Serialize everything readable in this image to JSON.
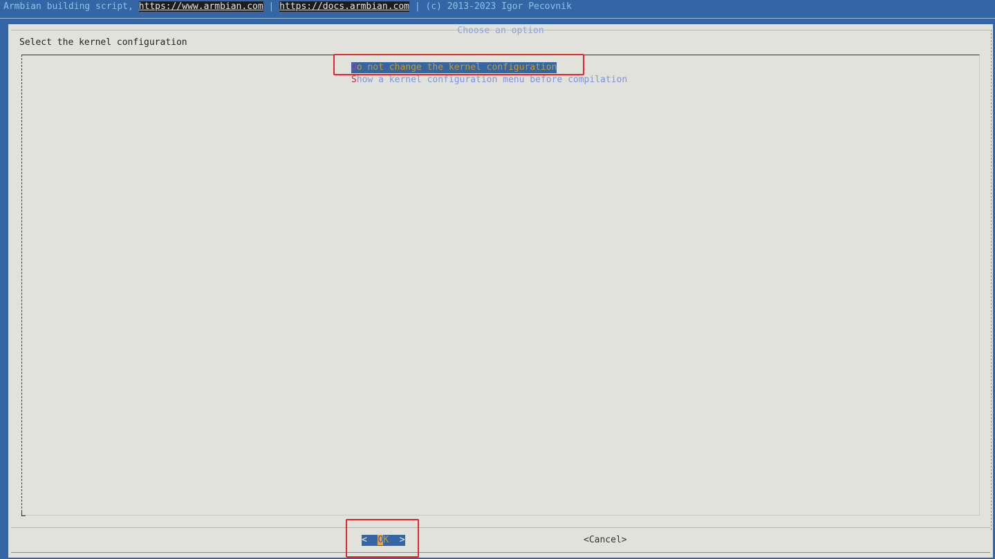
{
  "header": {
    "prefix": "Armbian building script, ",
    "link1": "https://www.armbian.com",
    "sep": " | ",
    "link2": "https://docs.armbian.com",
    "suffix": " | (c) 2013-2023 Igor Pecovnik"
  },
  "dialog": {
    "title": "Choose an option",
    "prompt": "Select the kernel configuration",
    "items": [
      {
        "hotkey": "D",
        "rest": "o not change the kernel configuration",
        "selected": true
      },
      {
        "hotkey": "S",
        "rest": "how a kernel configuration menu before compilation",
        "selected": false
      }
    ],
    "buttons": {
      "ok_left": "<  ",
      "ok_hot": "O",
      "ok_rest": "K",
      "ok_right": "  >",
      "cancel": "<Cancel>"
    }
  },
  "colors": {
    "background": "#3465a4",
    "dialog": "#e2e2dc",
    "highlight_box": "#e8242a"
  }
}
